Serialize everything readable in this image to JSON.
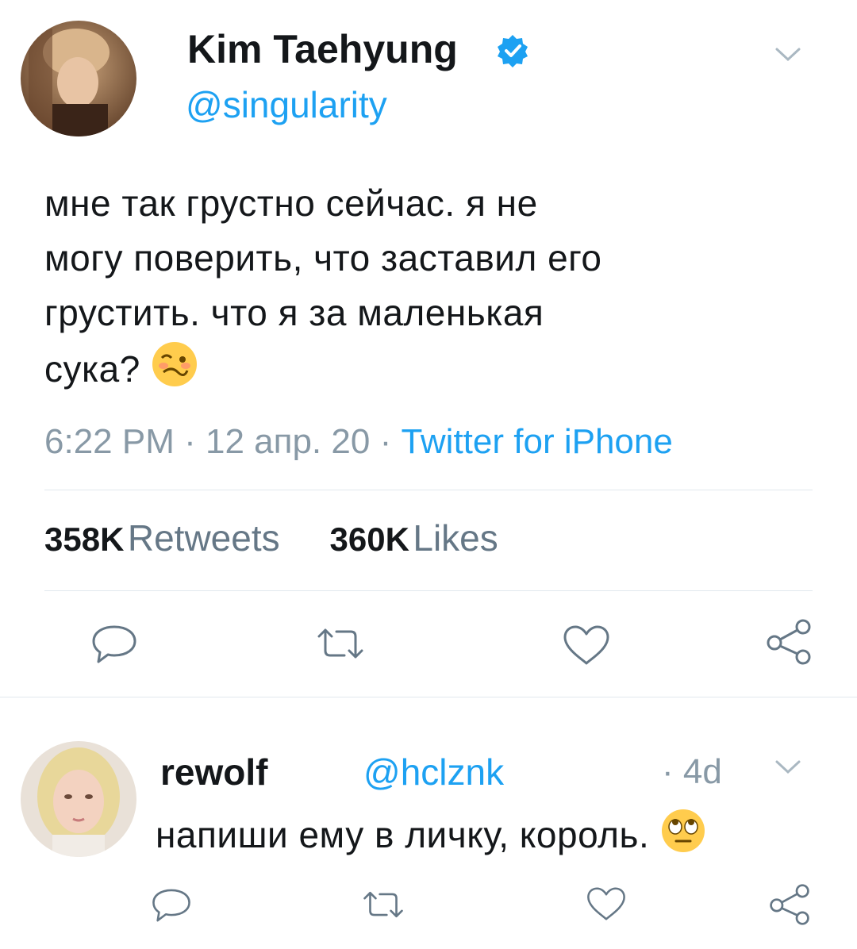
{
  "main_tweet": {
    "author_name": "Kim Taehyung",
    "handle": "@singularity",
    "verified_icon": "verified-badge-icon",
    "text_lines": [
      "мне так грустно сейчас. я не",
      "могу поверить, что заставил его",
      "грустить. что я за маленькая",
      "сука?"
    ],
    "emoji": "woozy-face-emoji",
    "time": "6:22 PM",
    "date": "12 апр. 20",
    "source": "Twitter for iPhone",
    "retweets_count": "358K",
    "retweets_label": "Retweets",
    "likes_count": "360K",
    "likes_label": "Likes"
  },
  "reply": {
    "author_name": "rewolf",
    "handle": "@hclznk",
    "age": "4d",
    "text": "напиши ему в личку, король.",
    "emoji": "face-with-rolling-eyes-emoji"
  },
  "colors": {
    "accent": "#1da1f2",
    "muted": "#8899a6",
    "divider": "#e1e8ed",
    "icon": "#657786"
  }
}
